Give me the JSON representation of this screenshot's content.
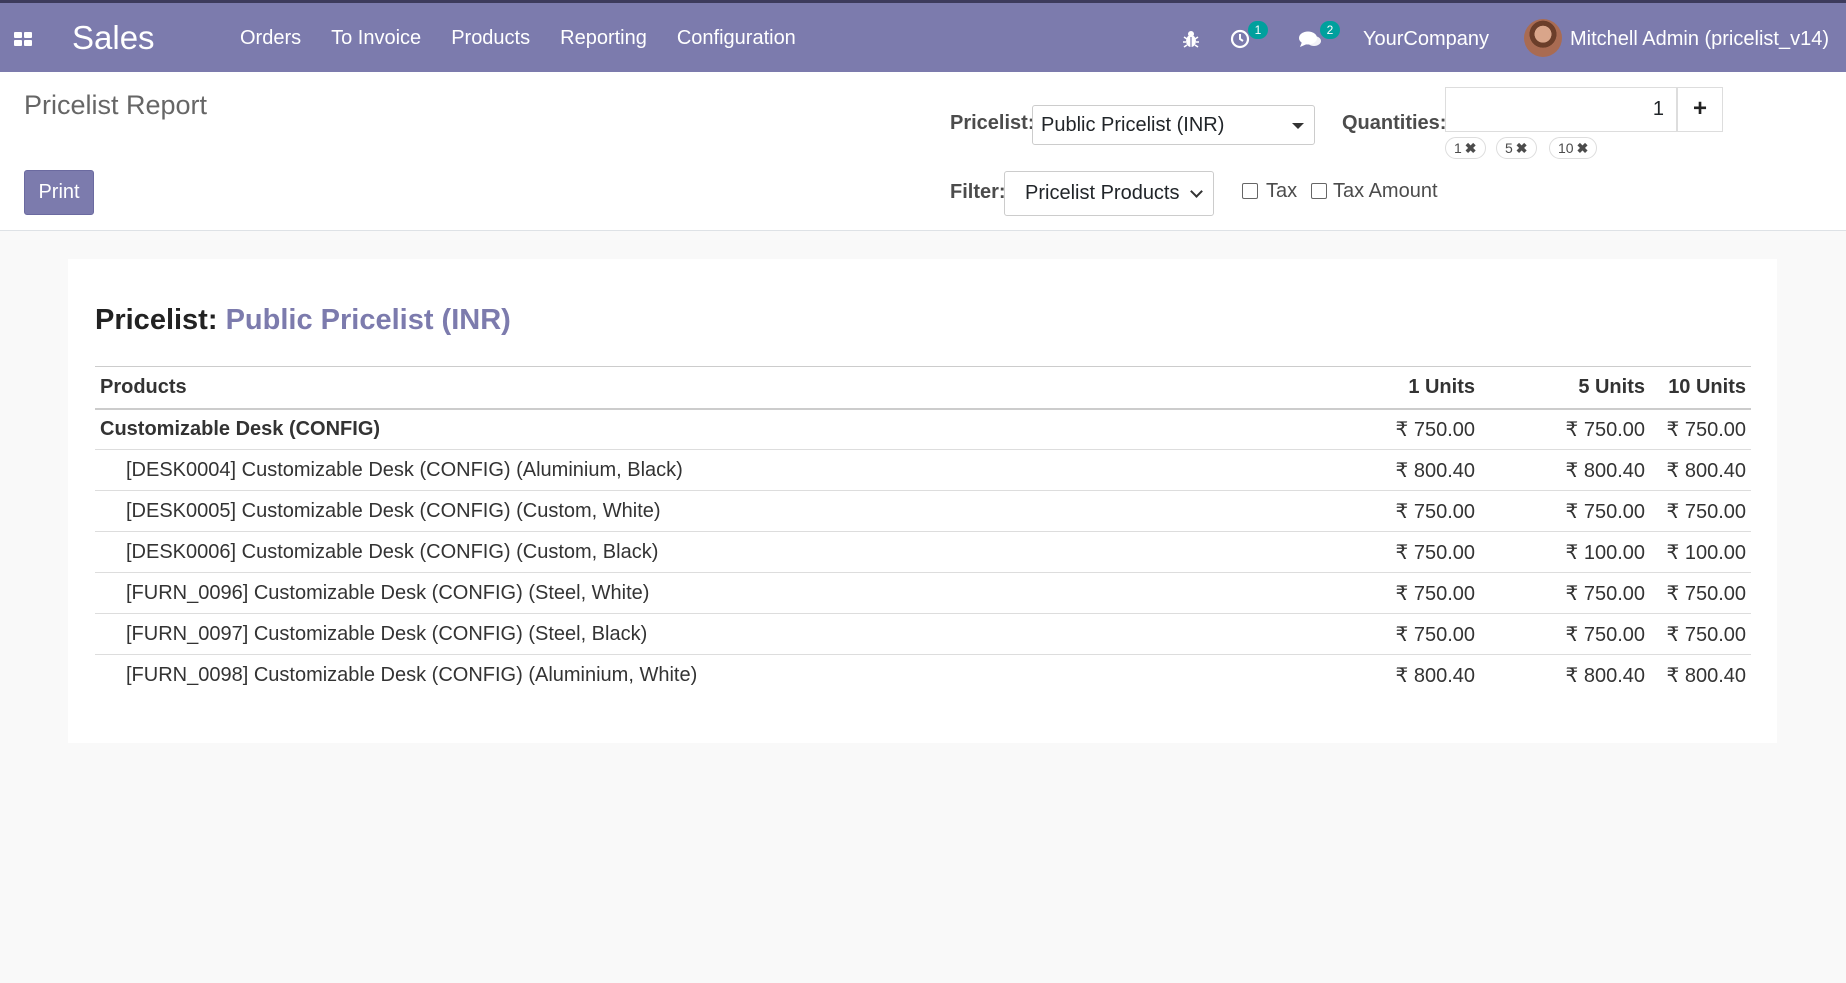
{
  "navbar": {
    "brand": "Sales",
    "menu": [
      "Orders",
      "To Invoice",
      "Products",
      "Reporting",
      "Configuration"
    ],
    "activity_count": "1",
    "messages_count": "2",
    "company": "YourCompany",
    "user": "Mitchell Admin (pricelist_v14)"
  },
  "control_panel": {
    "title": "Pricelist Report",
    "print_label": "Print",
    "pricelist_label": "Pricelist:",
    "pricelist_value": "Public Pricelist (INR)",
    "quantities_label": "Quantities:",
    "quantity_input": "1",
    "add_label": "+",
    "quantity_tags": [
      "1",
      "5",
      "10"
    ],
    "filter_label": "Filter:",
    "filter_value": "Pricelist Products",
    "tax_label": "Tax",
    "tax_amount_label": "Tax Amount"
  },
  "report": {
    "heading_prefix": "Pricelist:",
    "heading_name": "Public Pricelist (INR)",
    "columns": [
      "Products",
      "1 Units",
      "5 Units",
      "10 Units"
    ],
    "template": {
      "name": "Customizable Desk (CONFIG)",
      "prices": [
        "₹ 750.00",
        "₹ 750.00",
        "₹ 750.00"
      ]
    },
    "variants": [
      {
        "name": "[DESK0004] Customizable Desk (CONFIG) (Aluminium, Black)",
        "prices": [
          "₹ 800.40",
          "₹ 800.40",
          "₹ 800.40"
        ]
      },
      {
        "name": "[DESK0005] Customizable Desk (CONFIG) (Custom, White)",
        "prices": [
          "₹ 750.00",
          "₹ 750.00",
          "₹ 750.00"
        ]
      },
      {
        "name": "[DESK0006] Customizable Desk (CONFIG) (Custom, Black)",
        "prices": [
          "₹ 750.00",
          "₹ 100.00",
          "₹ 100.00"
        ]
      },
      {
        "name": "[FURN_0096] Customizable Desk (CONFIG) (Steel, White)",
        "prices": [
          "₹ 750.00",
          "₹ 750.00",
          "₹ 750.00"
        ]
      },
      {
        "name": "[FURN_0097] Customizable Desk (CONFIG) (Steel, Black)",
        "prices": [
          "₹ 750.00",
          "₹ 750.00",
          "₹ 750.00"
        ]
      },
      {
        "name": "[FURN_0098] Customizable Desk (CONFIG) (Aluminium, White)",
        "prices": [
          "₹ 800.40",
          "₹ 800.40",
          "₹ 800.40"
        ]
      }
    ]
  }
}
